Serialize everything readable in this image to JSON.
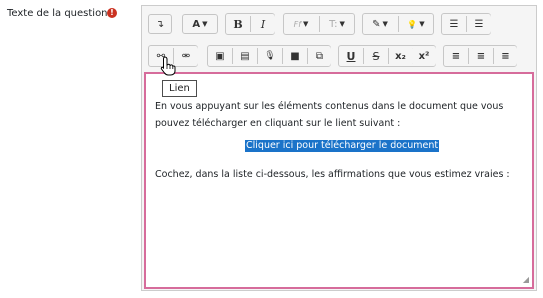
{
  "field": {
    "label": "Texte de la question",
    "required_icon": "exclamation-circle-icon",
    "required_mark": "!"
  },
  "toolbar": {
    "row1": {
      "collapse_glyph": "↴",
      "font_color_glyph": "A",
      "bold_label": "B",
      "italic_label": "I",
      "font_family_glyph": "Ff",
      "font_size_glyph": "T:",
      "brush_glyph": "✎",
      "lightbulb_glyph": "💡",
      "bullet_list_glyph": "☰",
      "numbered_list_glyph": "☰"
    },
    "row2": {
      "link_glyph": "⚯",
      "unlink_glyph": "⚮",
      "image_glyph": "▣",
      "media_glyph": "▤",
      "record_audio_glyph": "🎙",
      "record_video_glyph": "■",
      "manage_files_glyph": "⧉",
      "underline_label": "U",
      "strikethrough_label": "S",
      "subscript_label": "x₂",
      "superscript_label": "x²",
      "align_left_glyph": "≡",
      "align_center_glyph": "≡",
      "align_right_glyph": "≡"
    }
  },
  "tooltip": {
    "text": "Lien"
  },
  "content": {
    "paragraph1": "En vous appuyant sur les éléments contenus dans le document que vous pouvez télécharger en cliquant sur le lient suivant :",
    "link_text": "Cliquer ici pour télécharger le document",
    "paragraph2": "Cochez, dans la liste ci-dessous, les affirmations que vous estimez vraies :"
  },
  "colors": {
    "editor_border_focus": "#d66c9b",
    "selection": "#1a73c9",
    "required": "#ca3120"
  }
}
